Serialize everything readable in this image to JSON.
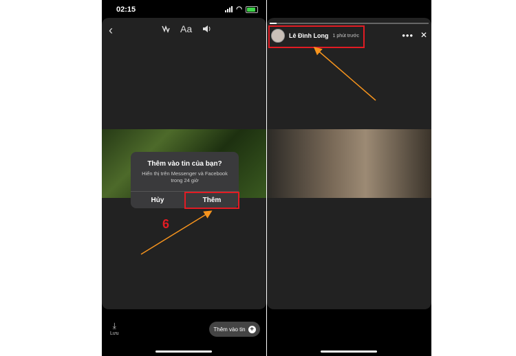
{
  "left_phone": {
    "status_time": "02:15",
    "toolbar": {
      "back_icon": "chevron-left-icon",
      "text_tool": "Aa"
    },
    "dialog": {
      "title": "Thêm vào tin của bạn?",
      "message": "Hiển thị trên Messenger và Facebook trong 24 giờ",
      "cancel_label": "Hủy",
      "confirm_label": "Thêm"
    },
    "step_number": "6",
    "save_label": "Lưu",
    "add_story_label": "Thêm vào tin"
  },
  "right_phone": {
    "author_name": "Lê Đình Long",
    "posted_time": "1 phút trước"
  },
  "colors": {
    "highlight": "#e31b23",
    "arrow": "#f7941d"
  }
}
